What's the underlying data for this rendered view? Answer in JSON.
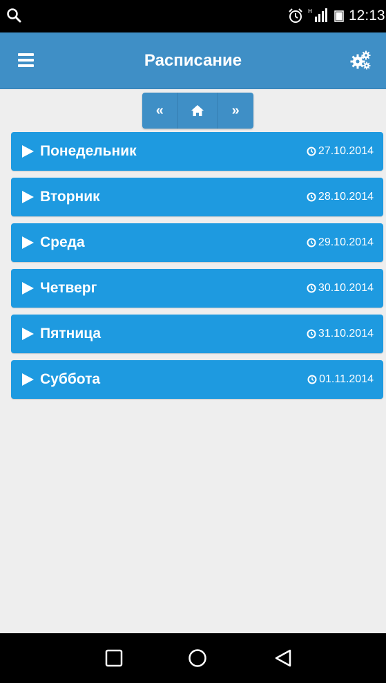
{
  "status_bar": {
    "time": "12:13",
    "icons": [
      "search-icon",
      "alarm-icon",
      "signal-icon",
      "battery-icon"
    ]
  },
  "app_bar": {
    "title": "Расписание",
    "left_icon": "menu-icon",
    "right_icon": "settings-gears-icon"
  },
  "week_nav": {
    "prev_label": "«",
    "home_icon": "home-icon",
    "next_label": "»"
  },
  "days": [
    {
      "name": "Понедельник",
      "date": "27.10.2014"
    },
    {
      "name": "Вторник",
      "date": "28.10.2014"
    },
    {
      "name": "Среда",
      "date": "29.10.2014"
    },
    {
      "name": "Четверг",
      "date": "30.10.2014"
    },
    {
      "name": "Пятница",
      "date": "31.10.2014"
    },
    {
      "name": "Суббота",
      "date": "01.11.2014"
    }
  ],
  "system_nav": {
    "icons": [
      "recent-apps-icon",
      "home-circle-icon",
      "back-icon"
    ]
  },
  "colors": {
    "app_bar": "#3f8fc6",
    "day_item": "#1e9ae0",
    "background": "#eeeeee",
    "system_bars": "#000000"
  }
}
